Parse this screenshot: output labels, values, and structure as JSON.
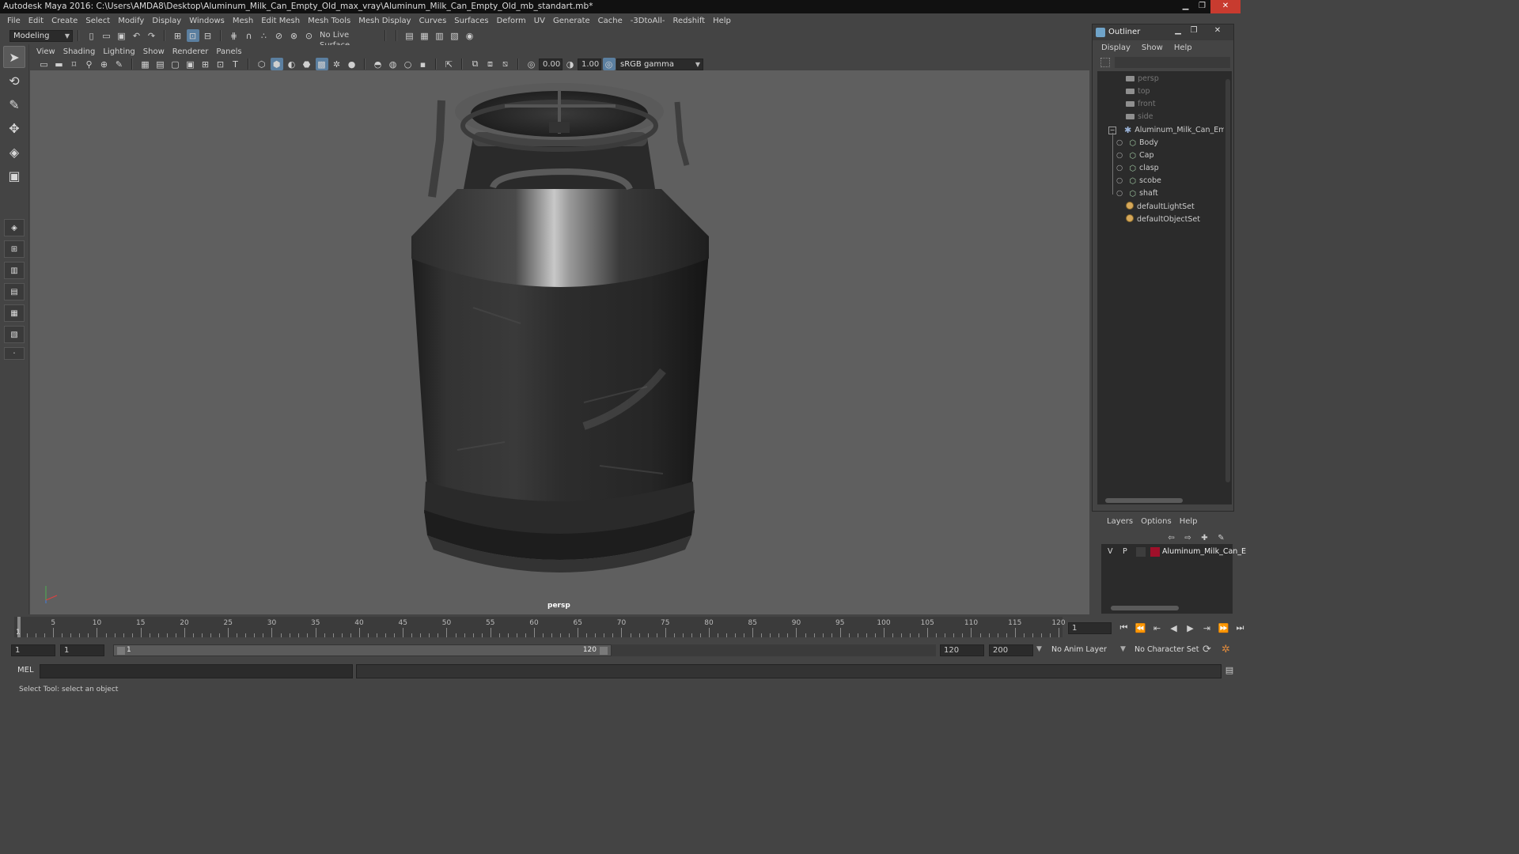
{
  "window": {
    "title": "Autodesk Maya 2016: C:\\Users\\AMDA8\\Desktop\\Aluminum_Milk_Can_Empty_Old_max_vray\\Aluminum_Milk_Can_Empty_Old_mb_standart.mb*",
    "controls": [
      "▁",
      "❐",
      "✕"
    ]
  },
  "menubar": [
    "File",
    "Edit",
    "Create",
    "Select",
    "Modify",
    "Display",
    "Windows",
    "Mesh",
    "Edit Mesh",
    "Mesh Tools",
    "Mesh Display",
    "Curves",
    "Surfaces",
    "Deform",
    "UV",
    "Generate",
    "Cache",
    "-3DtoAll-",
    "Redshift",
    "Help"
  ],
  "statusline": {
    "mode": "Modeling",
    "live_surface": "No Live Surface"
  },
  "panel": {
    "menus": [
      "View",
      "Shading",
      "Lighting",
      "Show",
      "Renderer",
      "Panels"
    ],
    "exposure": "0.00",
    "gamma": "1.00",
    "color_space": "sRGB gamma",
    "camera_label": "persp"
  },
  "timeline": {
    "ticks": [
      "5",
      "10",
      "15",
      "20",
      "25",
      "30",
      "35",
      "40",
      "45",
      "50",
      "55",
      "60",
      "65",
      "70",
      "75",
      "80",
      "85",
      "90",
      "95",
      "100",
      "105",
      "110",
      "115",
      "120"
    ],
    "current_frame": "1",
    "current_frame_field": "1"
  },
  "range": {
    "start": "1",
    "playback_start": "1",
    "slider_start": "1",
    "slider_end": "120",
    "playback_end": "120",
    "end": "200",
    "anim_layer": "No Anim Layer",
    "character_set": "No Character Set"
  },
  "cmdline": {
    "label": "MEL"
  },
  "helpline": {
    "text": "Select Tool: select an object"
  },
  "outliner": {
    "title": "Outliner",
    "menus": [
      "Display",
      "Show",
      "Help"
    ],
    "cameras": [
      "persp",
      "top",
      "front",
      "side"
    ],
    "group": "Aluminum_Milk_Can_Emp",
    "children": [
      "Body",
      "Cap",
      "clasp",
      "scobe",
      "shaft"
    ],
    "sets": [
      "defaultLightSet",
      "defaultObjectSet"
    ]
  },
  "layers": {
    "menus": [
      "Layers",
      "Options",
      "Help"
    ],
    "row": {
      "v": "V",
      "p": "P",
      "name": "Aluminum_Milk_Can_E",
      "color": "#a0102a"
    }
  }
}
